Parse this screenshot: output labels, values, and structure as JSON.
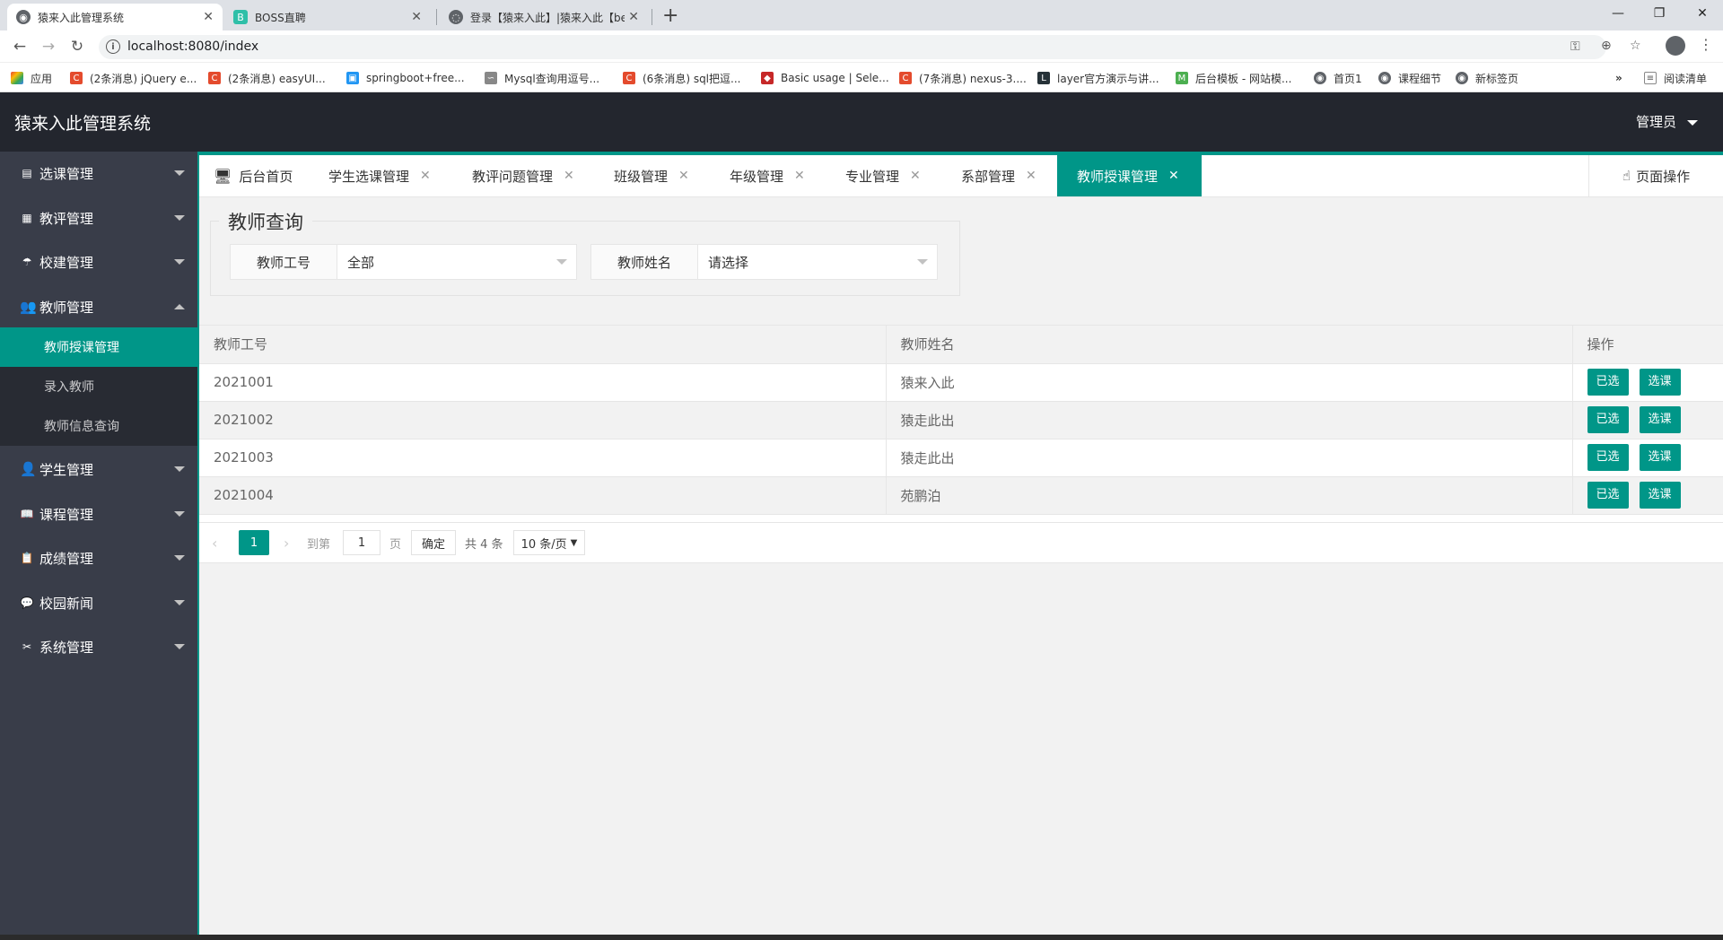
{
  "browser": {
    "tabs": [
      {
        "title": "猿来入此管理系统"
      },
      {
        "title": "BOSS直聘"
      },
      {
        "title": "登录【猿来入此】|猿来入此【be"
      }
    ],
    "url": "localhost:8080/index",
    "bookmarks": [
      "应用",
      "(2条消息) jQuery e...",
      "(2条消息) easyUI...",
      "springboot+free...",
      "Mysql查询用逗号...",
      "(6条消息) sql把逗...",
      "Basic usage | Sele...",
      "(7条消息) nexus-3....",
      "layer官方演示与讲...",
      "后台模板 - 网站模...",
      "首页1",
      "课程细节",
      "新标签页",
      "阅读清单"
    ]
  },
  "header": {
    "title": "猿来入此管理系统",
    "user": "管理员"
  },
  "sidebar": {
    "items": [
      {
        "label": "选课管理",
        "icon": "document-icon"
      },
      {
        "label": "教评管理",
        "icon": "grid-icon"
      },
      {
        "label": "校建管理",
        "icon": "umbrella-icon"
      },
      {
        "label": "教师管理",
        "icon": "users-icon"
      },
      {
        "label": "学生管理",
        "icon": "user-icon"
      },
      {
        "label": "课程管理",
        "icon": "book-icon"
      },
      {
        "label": "成绩管理",
        "icon": "clipboard-icon"
      },
      {
        "label": "校园新闻",
        "icon": "chat-icon"
      },
      {
        "label": "系统管理",
        "icon": "tools-icon"
      }
    ],
    "sub_items": [
      "教师授课管理",
      "录入教师",
      "教师信息查询"
    ]
  },
  "tabs": {
    "items": [
      "后台首页",
      "学生选课管理",
      "教评问题管理",
      "班级管理",
      "年级管理",
      "专业管理",
      "系部管理",
      "教师授课管理"
    ],
    "page_op": "页面操作"
  },
  "query": {
    "legend": "教师查询",
    "teacher_id_label": "教师工号",
    "teacher_id_value": "全部",
    "teacher_name_label": "教师姓名",
    "teacher_name_value": "请选择"
  },
  "table": {
    "headers": [
      "教师工号",
      "教师姓名",
      "操作"
    ],
    "rows": [
      {
        "id": "2021001",
        "name": "猿来入此"
      },
      {
        "id": "2021002",
        "name": "猿走此出"
      },
      {
        "id": "2021003",
        "name": "猿走此出"
      },
      {
        "id": "2021004",
        "name": "苑鹏泊"
      }
    ],
    "btn_selected": "已选",
    "btn_select": "选课"
  },
  "pager": {
    "current": "1",
    "goto_label": "到第",
    "goto_value": "1",
    "page_label": "页",
    "confirm": "确定",
    "total": "共 4 条",
    "page_size": "10 条/页"
  },
  "colors": {
    "accent": "#009688",
    "header": "#23262e",
    "sidebar": "#393d49"
  }
}
